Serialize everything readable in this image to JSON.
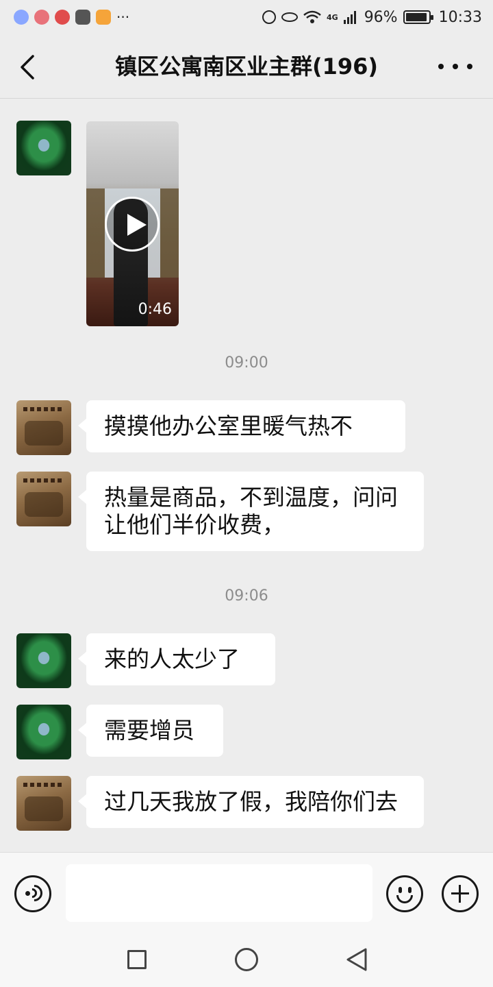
{
  "status_bar": {
    "notif_more": "···",
    "network": "4G",
    "battery": "96%",
    "battery_level": 0.96,
    "time": "10:33"
  },
  "nav": {
    "title": "镇区公寓南区业主群(196)"
  },
  "chat": {
    "video": {
      "duration": "0:46"
    },
    "timestamps": [
      "09:00",
      "09:06"
    ],
    "messages": [
      {
        "avatar": "book-avatar",
        "text": "摸摸他办公室里暖气热不"
      },
      {
        "avatar": "book-avatar",
        "text": "热量是商品，不到温度，问问让他们半价收费，"
      },
      {
        "avatar": "lotus-avatar",
        "text": "来的人太少了"
      },
      {
        "avatar": "lotus-avatar",
        "text": "需要增员"
      },
      {
        "avatar": "book-avatar",
        "text": "过几天我放了假，我陪你们去"
      }
    ]
  },
  "input_bar": {
    "placeholder": "",
    "icons": [
      "voice-icon",
      "emoji-icon",
      "plus-icon"
    ]
  },
  "system_nav": {
    "icons": [
      "recent-apps-icon",
      "home-icon",
      "back-icon"
    ]
  },
  "colors": {
    "background": "#ededed",
    "bubble": "#ffffff",
    "timestamp": "#8c8c8c"
  }
}
